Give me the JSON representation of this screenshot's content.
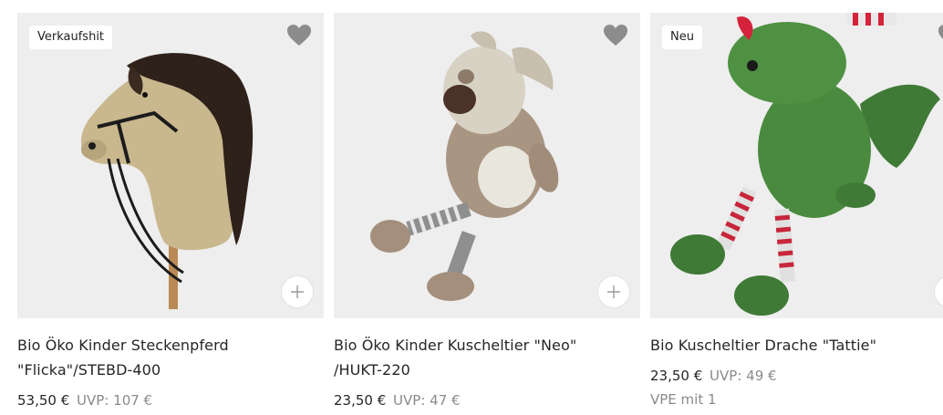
{
  "products": [
    {
      "badge": "Verkaufshit",
      "title_line1": "Bio Öko Kinder Steckenpferd",
      "title_line2": "\"Flicka\"/STEBD-400",
      "price": "53,50 €",
      "uvp": "UVP: 107 €"
    },
    {
      "title_line1": "Bio Öko Kinder Kuscheltier \"Neo\"",
      "title_line2": "/HUKT-220",
      "price": "23,50 €",
      "uvp": "UVP: 47 €"
    },
    {
      "badge": "Neu",
      "title_line1": "Bio Kuscheltier Drache \"Tattie\"",
      "price": "23,50 €",
      "uvp": "UVP: 49 €",
      "vpe": "VPE mit 1"
    }
  ],
  "icons": {
    "wishlist": "heart-icon",
    "add": "plus-icon"
  },
  "colors": {
    "image_bg": "#eeeeee",
    "heart": "#8c8c8c",
    "muted_text": "#8a8a8a"
  }
}
